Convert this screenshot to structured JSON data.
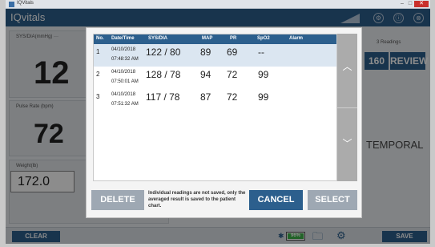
{
  "window": {
    "title": "IQVitals",
    "min": "–",
    "max": "□",
    "close": "✕"
  },
  "app": {
    "brand": "IQvitals",
    "header_icons": [
      "⚙",
      "ⓘ",
      "⊗"
    ]
  },
  "panels": {
    "sysdia_label": "SYS/DIA(mmHg) ···",
    "sysdia_value": "12",
    "pulse_label": "Pulse Rate (bpm)",
    "pulse_value": "72",
    "weight_label": "Weight(lb)",
    "weight_value": "172.0",
    "readings_label": "3 Readings",
    "btn_160": "160",
    "btn_review": "REVIEW",
    "temporal": "TEMPORAL"
  },
  "bottom": {
    "clear": "CLEAR",
    "battery": "96%",
    "save": "SAVE"
  },
  "modal": {
    "headers": {
      "no": "No.",
      "datetime": "Date/Time",
      "sysdia": "SYS/DIA",
      "map": "MAP",
      "pr": "PR",
      "spo2": "SpO2",
      "alarm": "Alarm"
    },
    "rows": [
      {
        "no": "1",
        "date": "04/10/2018",
        "time": "07:48:32 AM",
        "sysdia": "122 / 80",
        "map": "89",
        "pr": "69",
        "spo2": "--"
      },
      {
        "no": "2",
        "date": "04/10/2018",
        "time": "07:50:01 AM",
        "sysdia": "128 / 78",
        "map": "94",
        "pr": "72",
        "spo2": "99"
      },
      {
        "no": "3",
        "date": "04/10/2018",
        "time": "07:51:32 AM",
        "sysdia": "117 / 78",
        "map": "87",
        "pr": "72",
        "spo2": "99"
      }
    ],
    "note": "Individual readings are not saved, only the averaged result is saved to the patient chart.",
    "delete": "DELETE",
    "cancel": "CANCEL",
    "select": "SELECT",
    "scroll_up": "︿",
    "scroll_down": "﹀"
  }
}
